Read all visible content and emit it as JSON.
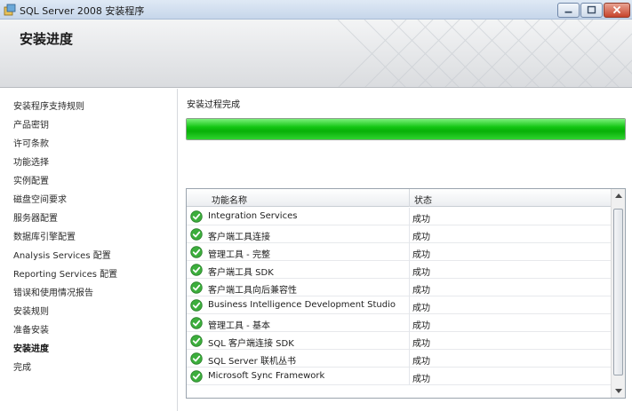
{
  "window": {
    "title": "SQL Server 2008 安装程序"
  },
  "header": {
    "title": "安装进度"
  },
  "nav": {
    "items": [
      {
        "label": "安装程序支持规则"
      },
      {
        "label": "产品密钥"
      },
      {
        "label": "许可条款"
      },
      {
        "label": "功能选择"
      },
      {
        "label": "实例配置"
      },
      {
        "label": "磁盘空间要求"
      },
      {
        "label": "服务器配置"
      },
      {
        "label": "数据库引擎配置"
      },
      {
        "label": "Analysis Services 配置"
      },
      {
        "label": "Reporting Services 配置"
      },
      {
        "label": "错误和使用情况报告"
      },
      {
        "label": "安装规则"
      },
      {
        "label": "准备安装"
      },
      {
        "label": "安装进度",
        "current": true
      },
      {
        "label": "完成"
      }
    ]
  },
  "main": {
    "status_text": "安装过程完成",
    "progress": 1.0,
    "progress_color": "#12c512"
  },
  "table": {
    "columns": {
      "name": "功能名称",
      "status": "状态"
    },
    "rows": [
      {
        "icon": "success-check-icon",
        "name": "Integration Services",
        "status": "成功"
      },
      {
        "icon": "success-check-icon",
        "name": "客户端工具连接",
        "status": "成功"
      },
      {
        "icon": "success-check-icon",
        "name": "管理工具 - 完整",
        "status": "成功"
      },
      {
        "icon": "success-check-icon",
        "name": "客户端工具 SDK",
        "status": "成功"
      },
      {
        "icon": "success-check-icon",
        "name": "客户端工具向后兼容性",
        "status": "成功"
      },
      {
        "icon": "success-check-icon",
        "name": "Business Intelligence Development Studio",
        "status": "成功"
      },
      {
        "icon": "success-check-icon",
        "name": "管理工具 - 基本",
        "status": "成功"
      },
      {
        "icon": "success-check-icon",
        "name": "SQL 客户端连接 SDK",
        "status": "成功"
      },
      {
        "icon": "success-check-icon",
        "name": "SQL Server 联机丛书",
        "status": "成功"
      },
      {
        "icon": "success-check-icon",
        "name": "Microsoft Sync Framework",
        "status": "成功"
      }
    ],
    "success_icon_color": "#3cae3c"
  }
}
